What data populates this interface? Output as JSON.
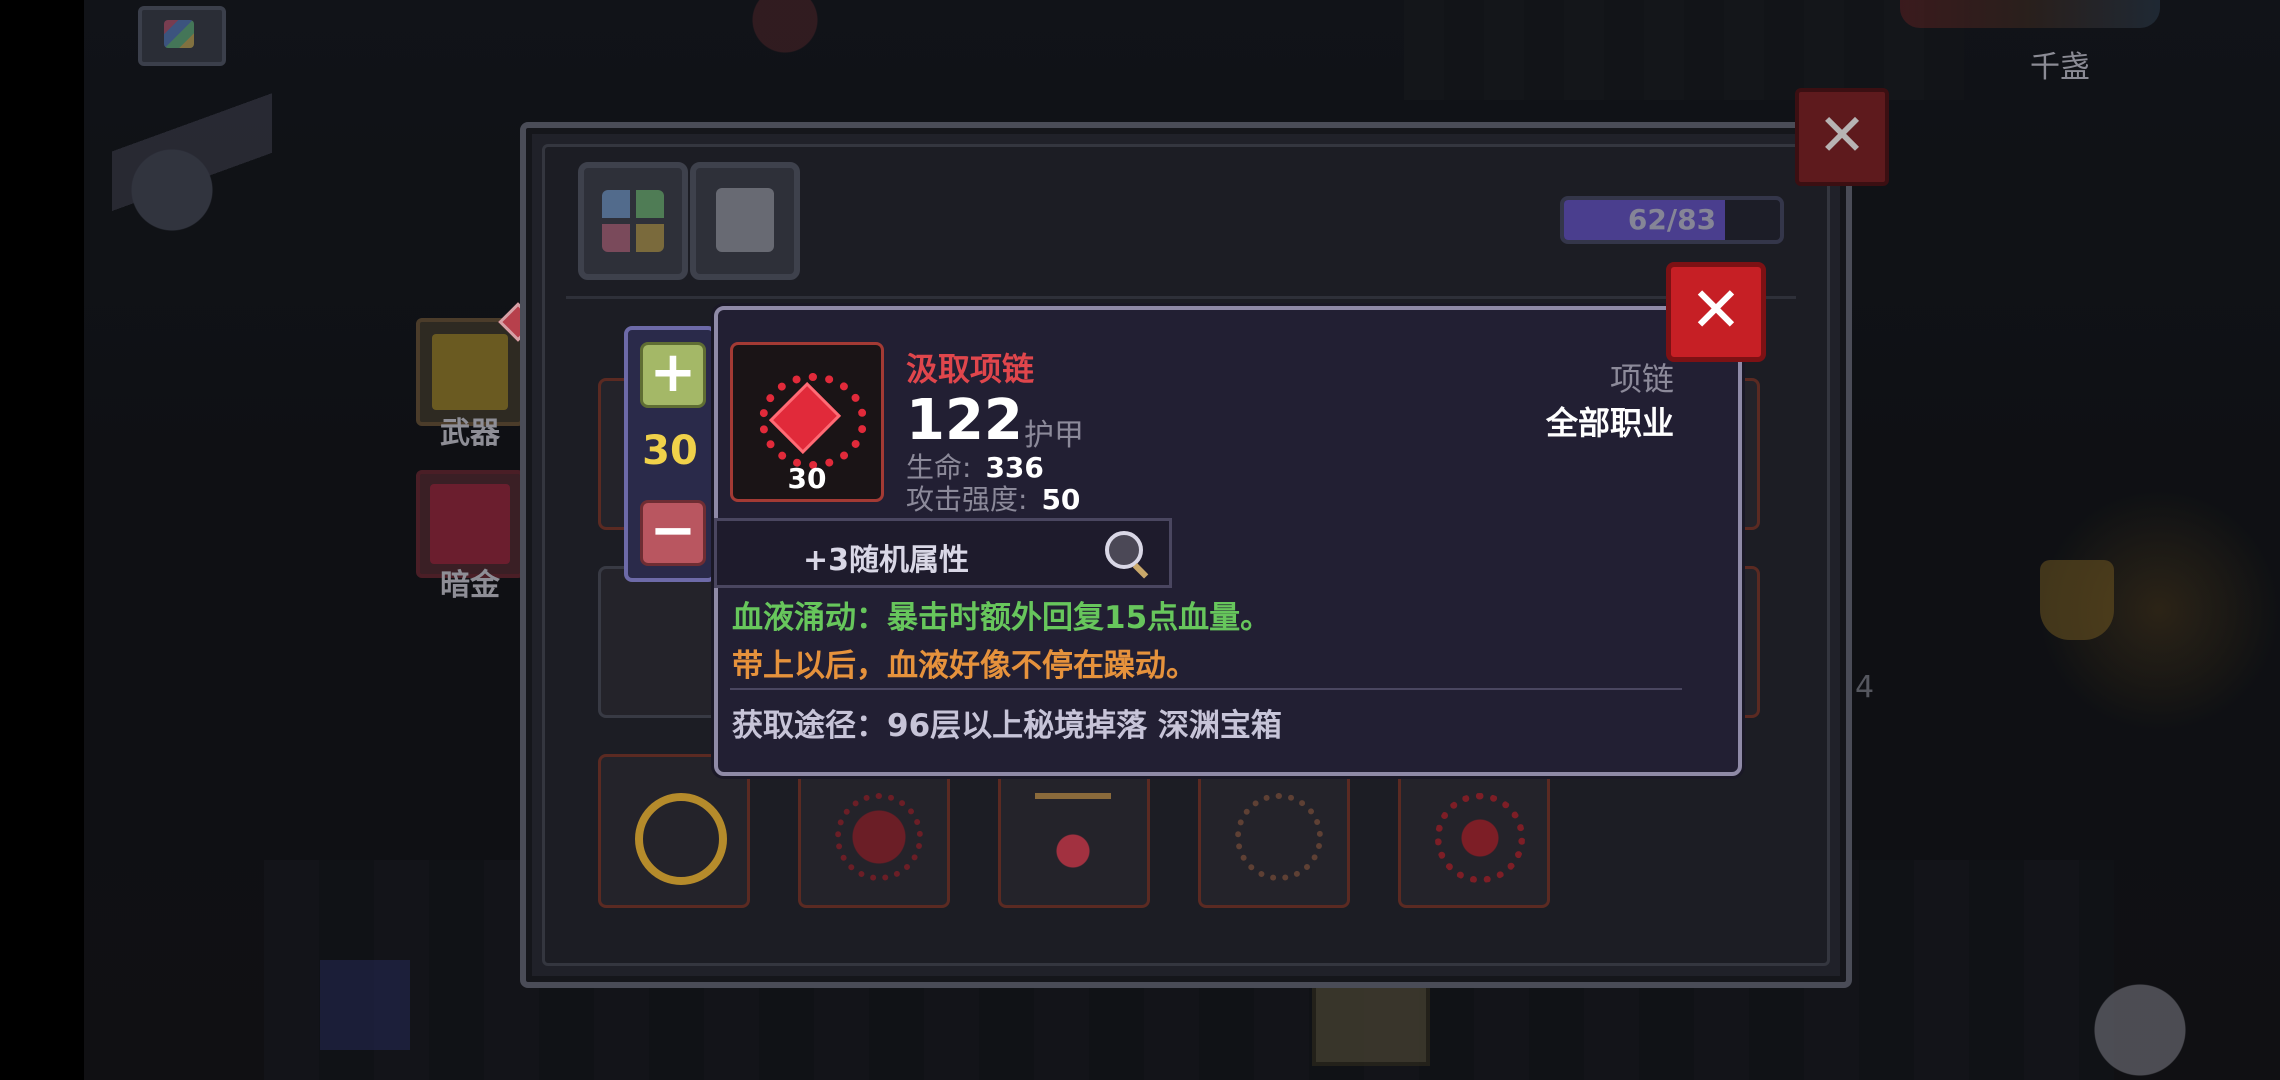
{
  "background": {
    "top_right_label": "千盏",
    "side_tabs": [
      {
        "label": "武器"
      },
      {
        "label": "暗金"
      }
    ],
    "right_glyph": "4"
  },
  "inventory": {
    "capacity_text": "62/83",
    "capacity_fraction": 0.747,
    "close_label": "✕"
  },
  "stepper": {
    "plus_label": "+",
    "minus_label": "−",
    "value": "30"
  },
  "tooltip": {
    "close_label": "✕",
    "item_name": "汲取项链",
    "item_level": "30",
    "armor_value": "122",
    "armor_label": "护甲",
    "stats": [
      {
        "key": "生命:",
        "value": "336"
      },
      {
        "key": "攻击强度:",
        "value": "50"
      }
    ],
    "item_type": "项链",
    "item_class": "全部职业",
    "random_attr": "+3随机属性",
    "effect": "血液涌动：暴击时额外回复15点血量。",
    "flavor": "带上以后，血液好像不停在躁动。",
    "source": "获取途径：96层以上秘境掉落 深渊宝箱"
  },
  "colors": {
    "item_name": "#e0464c",
    "effect": "#67c65c",
    "flavor": "#e6923c",
    "level": "#f0d14a",
    "close_red": "#c61f25"
  },
  "icons": [
    "portal-icon",
    "close-icon",
    "plus-icon",
    "minus-icon",
    "magnifier-icon",
    "necklace-icon",
    "all-items-icon",
    "armor-tab-icon"
  ]
}
